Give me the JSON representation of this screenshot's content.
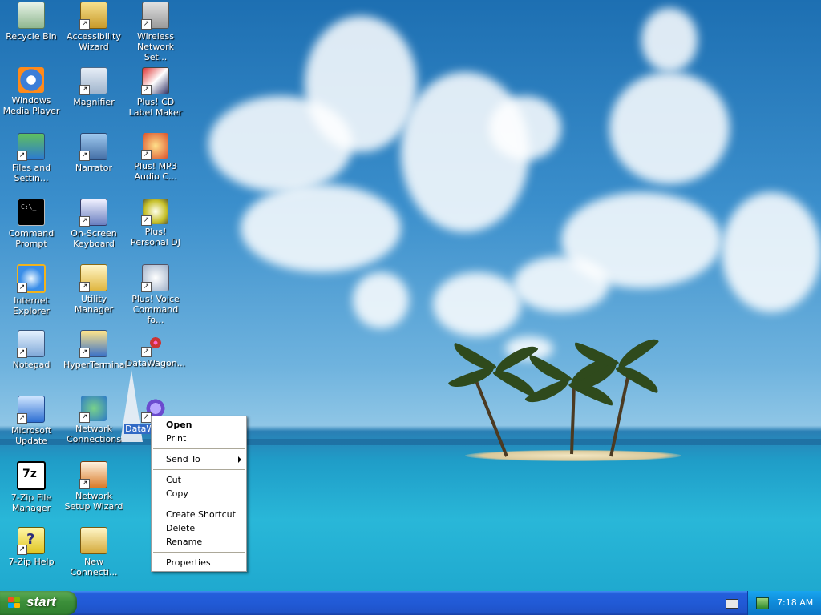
{
  "desktop_icons": [
    {
      "label": "Recycle Bin",
      "icon": "recycle-bin-icon"
    },
    {
      "label": "Accessibility Wizard",
      "icon": "accessibility-wizard-icon"
    },
    {
      "label": "Wireless Network Set...",
      "icon": "wireless-network-icon"
    },
    {
      "label": "Windows Media Player",
      "icon": "windows-media-player-icon"
    },
    {
      "label": "Magnifier",
      "icon": "magnifier-icon"
    },
    {
      "label": "Plus! CD Label Maker",
      "icon": "cd-label-maker-icon"
    },
    {
      "label": "Files and Settin...",
      "icon": "files-settings-transfer-icon"
    },
    {
      "label": "Narrator",
      "icon": "narrator-icon"
    },
    {
      "label": "Plus! MP3 Audio C...",
      "icon": "mp3-audio-converter-icon"
    },
    {
      "label": "Command Prompt",
      "icon": "command-prompt-icon"
    },
    {
      "label": "On-Screen Keyboard",
      "icon": "on-screen-keyboard-icon"
    },
    {
      "label": "Plus! Personal DJ",
      "icon": "personal-dj-icon"
    },
    {
      "label": "Internet Explorer",
      "icon": "internet-explorer-icon"
    },
    {
      "label": "Utility Manager",
      "icon": "utility-manager-icon"
    },
    {
      "label": "Plus! Voice Command fo...",
      "icon": "voice-command-icon"
    },
    {
      "label": "Notepad",
      "icon": "notepad-icon"
    },
    {
      "label": "HyperTerminal",
      "icon": "hyperterminal-icon"
    },
    {
      "label": "DataWagon...",
      "icon": "datawagon-icon"
    },
    {
      "label": "Microsoft Update",
      "icon": "microsoft-update-icon"
    },
    {
      "label": "Network Connections",
      "icon": "network-connections-icon"
    },
    {
      "label": "DataWa... m (",
      "icon": "datawagon-icon"
    },
    {
      "label": "7-Zip File Manager",
      "icon": "seven-zip-icon"
    },
    {
      "label": "Network Setup Wizard",
      "icon": "network-setup-wizard-icon"
    },
    {
      "label": "7-Zip Help",
      "icon": "help-icon"
    },
    {
      "label": "New Connecti...",
      "icon": "new-connection-icon"
    }
  ],
  "context_menu": {
    "open": "Open",
    "print": "Print",
    "send_to": "Send To",
    "cut": "Cut",
    "copy": "Copy",
    "create_shortcut": "Create Shortcut",
    "delete": "Delete",
    "rename": "Rename",
    "properties": "Properties"
  },
  "taskbar": {
    "start_label": "start",
    "clock": "7:18 AM"
  },
  "colors": {
    "taskbar": "#245edb",
    "start_button": "#3c8f3a",
    "selection": "#316ac5",
    "tray": "#0f8ad9"
  }
}
